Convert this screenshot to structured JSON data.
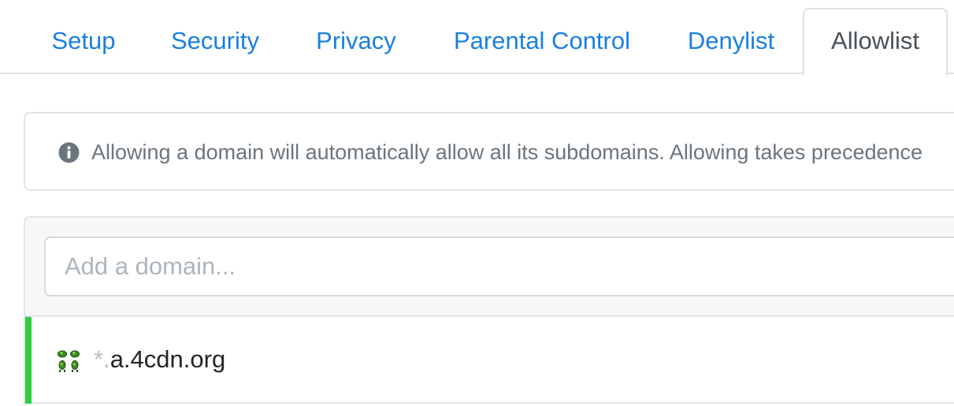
{
  "tabs": [
    {
      "label": "Setup",
      "active": false
    },
    {
      "label": "Security",
      "active": false
    },
    {
      "label": "Privacy",
      "active": false
    },
    {
      "label": "Parental Control",
      "active": false
    },
    {
      "label": "Denylist",
      "active": false
    },
    {
      "label": "Allowlist",
      "active": true
    }
  ],
  "alert": {
    "icon": "info-circle-icon",
    "text": "Allowing a domain will automatically allow all its subdomains. Allowing takes precedence"
  },
  "allowlist": {
    "input_placeholder": "Add a domain...",
    "input_value": "",
    "items": [
      {
        "wildcard_prefix": "*.",
        "domain": "a.4cdn.org",
        "favicon": "clover-favicon-icon",
        "status_color": "#2ecc40"
      }
    ]
  },
  "colors": {
    "link": "#1a7fe0",
    "active_tab_text": "#495057",
    "muted_text": "#6c757d",
    "enabled_status": "#2ecc40"
  }
}
